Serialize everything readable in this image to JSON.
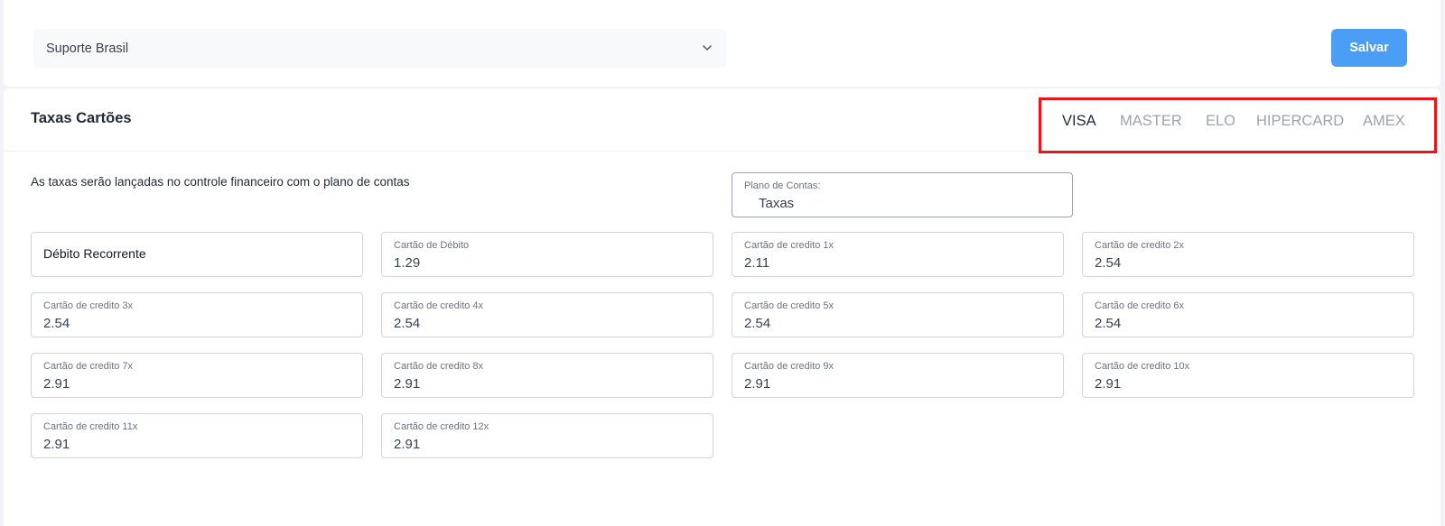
{
  "header": {
    "select_value": "Suporte Brasil",
    "save_label": "Salvar"
  },
  "card": {
    "title": "Taxas Cartões",
    "tabs": [
      {
        "label": "VISA",
        "active": true
      },
      {
        "label": "MASTER",
        "active": false
      },
      {
        "label": "ELO",
        "active": false
      },
      {
        "label": "HIPERCARD",
        "active": false
      },
      {
        "label": "AMEX",
        "active": false
      }
    ],
    "info_text": "As taxas serão lançadas no controle financeiro com o plano de contas",
    "plano": {
      "label": "Plano de Contas:",
      "value": "Taxas"
    }
  },
  "fields": [
    {
      "label": "",
      "value": "Débito Recorrente"
    },
    {
      "label": "Cartão de Débito",
      "value": "1.29"
    },
    {
      "label": "Cartão de credito 1x",
      "value": "2.11"
    },
    {
      "label": "Cartão de credito 2x",
      "value": "2.54"
    },
    {
      "label": "Cartão de credito 3x",
      "value": "2.54"
    },
    {
      "label": "Cartão de credito 4x",
      "value": "2.54"
    },
    {
      "label": "Cartão de credito 5x",
      "value": "2.54"
    },
    {
      "label": "Cartão de credito 6x",
      "value": "2.54"
    },
    {
      "label": "Cartão de credito 7x",
      "value": "2.91"
    },
    {
      "label": "Cartão de credito 8x",
      "value": "2.91"
    },
    {
      "label": "Cartão de credito 9x",
      "value": "2.91"
    },
    {
      "label": "Cartão de credito 10x",
      "value": "2.91"
    },
    {
      "label": "Cartão de credito 11x",
      "value": "2.91"
    },
    {
      "label": "Cartão de credito 12x",
      "value": "2.91"
    }
  ],
  "colors": {
    "accent": "#4a9ef5",
    "highlight": "#e8151b"
  }
}
